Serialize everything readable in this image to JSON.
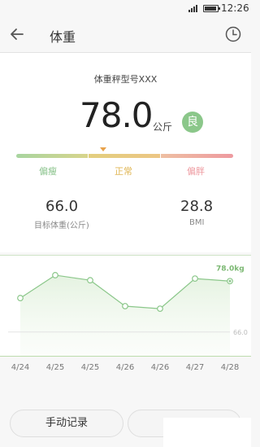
{
  "status_bar": {
    "time": "12:26",
    "icons": [
      "signal-icon",
      "battery-icon"
    ]
  },
  "header": {
    "title": "体重",
    "left_icon": "back-arrow-icon",
    "right_icon": "history-clock-icon"
  },
  "summary": {
    "model_name": "体重秤型号XXX",
    "weight": "78.0",
    "unit": "公斤",
    "grade_badge": "良",
    "scale_labels": [
      "偏瘦",
      "正常",
      "偏胖"
    ],
    "scale_colors": [
      "#8cc48e",
      "#e0b654",
      "#ee9aa0"
    ],
    "target_weight": "66.0",
    "target_caption": "目标体重(公斤)",
    "bmi": "28.8",
    "bmi_caption": "BMI"
  },
  "chart_data": {
    "type": "line",
    "x": [
      "4/24",
      "4/25",
      "4/25",
      "4/26",
      "4/26",
      "4/27",
      "4/28"
    ],
    "values": [
      74.0,
      79.4,
      78.2,
      72.1,
      71.5,
      78.6,
      78.0
    ],
    "target_line": 66.0,
    "target_label": "66.0",
    "last_label": "78.0kg",
    "ylim": [
      60,
      84
    ],
    "color": "#8bc78a"
  },
  "actions": {
    "manual_record": "手动记录",
    "second_button": ""
  }
}
